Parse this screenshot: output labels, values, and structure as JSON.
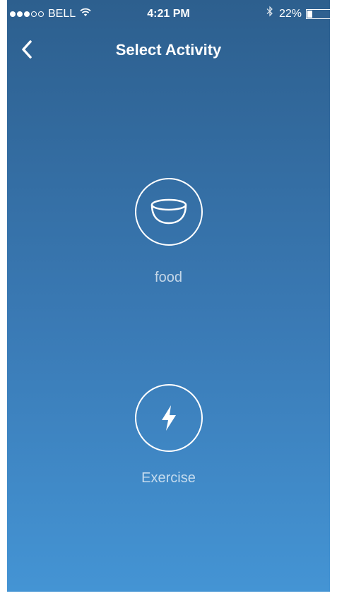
{
  "status_bar": {
    "carrier": "BELL",
    "signal_dots_filled": 3,
    "signal_dots_total": 5,
    "time": "4:21 PM",
    "battery_pct": "22%",
    "battery_level": 0.22,
    "icons": [
      "wifi-icon",
      "bluetooth-icon",
      "battery-icon"
    ]
  },
  "nav": {
    "title": "Select Activity",
    "back_icon": "chevron-left-icon"
  },
  "activities": [
    {
      "label": "food",
      "icon": "bowl-icon"
    },
    {
      "label": "Exercise",
      "icon": "lightning-icon"
    }
  ],
  "colors": {
    "gradient_top": "#2d5f8e",
    "gradient_bottom": "#4494d4",
    "foreground": "#ffffff"
  }
}
